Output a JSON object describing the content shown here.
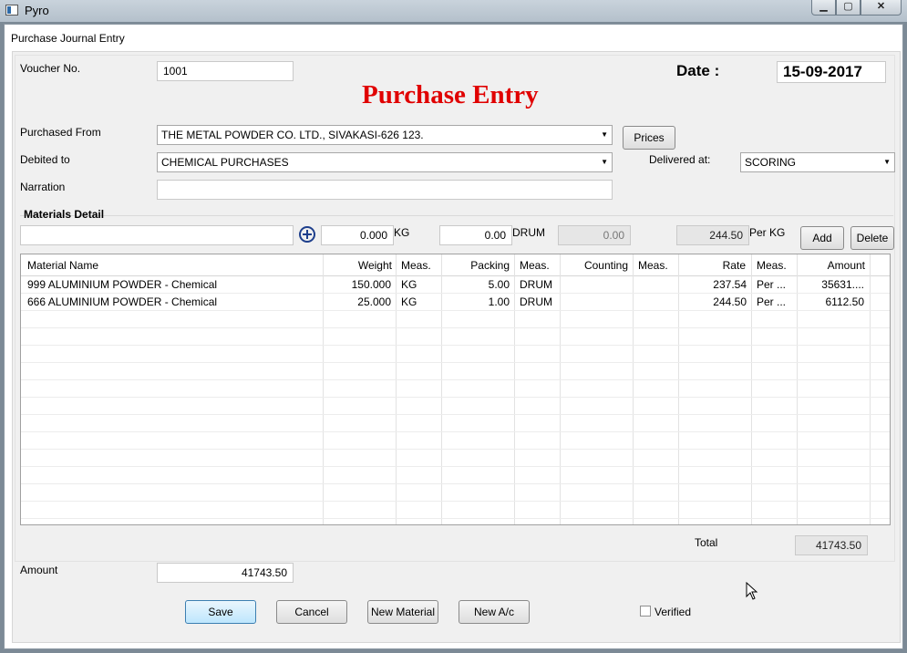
{
  "window": {
    "title": "Pyro",
    "min": "▁",
    "max": "▢",
    "close": "✕"
  },
  "form": {
    "title": "Purchase Journal Entry",
    "heading": "Purchase Entry",
    "voucher_label": "Voucher No.",
    "voucher_value": "1001",
    "date_label": "Date :",
    "date_value": "15-09-2017",
    "purchased_from_label": "Purchased From",
    "purchased_from_value": "THE METAL POWDER CO. LTD., SIVAKASI-626 123.",
    "prices_button": "Prices",
    "debited_to_label": "Debited to",
    "debited_to_value": "CHEMICAL PURCHASES",
    "delivered_at_label": "Delivered at:",
    "delivered_at_value": "SCORING",
    "narration_label": "Narration",
    "narration_value": ""
  },
  "materials": {
    "group_title": "Materials Detail",
    "entry_material": "",
    "entry_weight": "0.000",
    "entry_weight_unit": "KG",
    "entry_packing": "0.00",
    "entry_packing_unit": "DRUM",
    "entry_counting": "0.00",
    "entry_rate": "244.50",
    "entry_rate_unit": "Per KG",
    "add_button": "Add",
    "delete_button": "Delete",
    "columns": [
      "Material Name",
      "Weight",
      "Meas.",
      "Packing",
      "Meas.",
      "Counting",
      "Meas.",
      "Rate",
      "Meas.",
      "Amount"
    ],
    "rows": [
      [
        "999 ALUMINIUM POWDER - Chemical",
        "150.000",
        "KG",
        "5.00",
        "DRUM",
        "",
        "",
        "237.54",
        "Per ...",
        "35631...."
      ],
      [
        "666 ALUMINIUM POWDER - Chemical",
        "25.000",
        "KG",
        "1.00",
        "DRUM",
        "",
        "",
        "244.50",
        "Per ...",
        "6112.50"
      ]
    ],
    "total_label": "Total",
    "total_value": "41743.50"
  },
  "footer": {
    "amount_label": "Amount",
    "amount_value": "41743.50",
    "save": "Save",
    "cancel": "Cancel",
    "new_material": "New Material",
    "new_ac": "New A/c",
    "verified_label": "Verified",
    "verified_checked": false
  }
}
